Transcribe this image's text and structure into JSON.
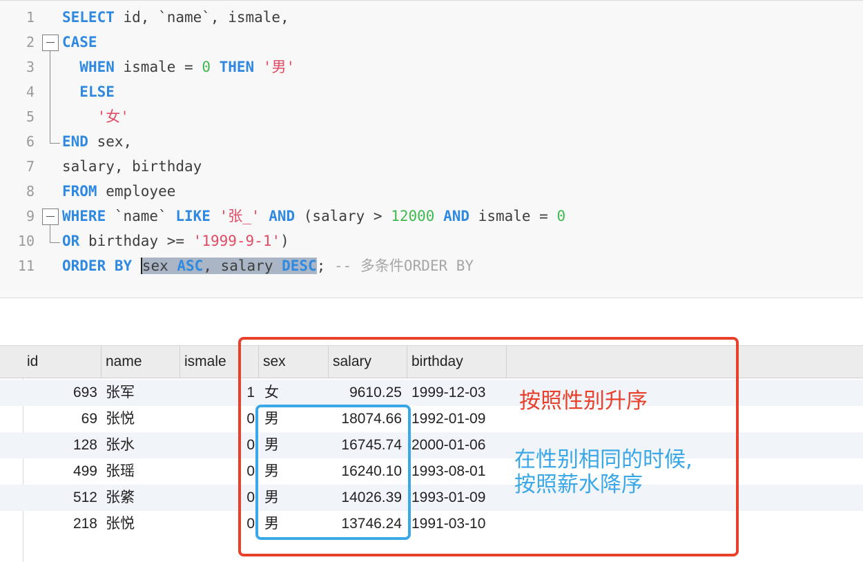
{
  "editor": {
    "line_numbers": [
      "1",
      "2",
      "3",
      "4",
      "5",
      "6",
      "7",
      "8",
      "9",
      "10",
      "11"
    ],
    "lines": [
      [
        {
          "t": "SELECT",
          "c": "kw"
        },
        {
          "t": " id, `name`, ismale,",
          "c": ""
        }
      ],
      [
        {
          "t": "CASE",
          "c": "kw"
        }
      ],
      [
        {
          "t": "  ",
          "c": ""
        },
        {
          "t": "WHEN",
          "c": "kw"
        },
        {
          "t": " ismale = ",
          "c": ""
        },
        {
          "t": "0",
          "c": "num"
        },
        {
          "t": " ",
          "c": ""
        },
        {
          "t": "THEN",
          "c": "kw"
        },
        {
          "t": " ",
          "c": ""
        },
        {
          "t": "'男'",
          "c": "str"
        }
      ],
      [
        {
          "t": "  ",
          "c": ""
        },
        {
          "t": "ELSE",
          "c": "kw"
        }
      ],
      [
        {
          "t": "    ",
          "c": ""
        },
        {
          "t": "'女'",
          "c": "str"
        }
      ],
      [
        {
          "t": "END",
          "c": "kw"
        },
        {
          "t": " sex,",
          "c": ""
        }
      ],
      [
        {
          "t": "salary, birthday",
          "c": ""
        }
      ],
      [
        {
          "t": "FROM",
          "c": "kw"
        },
        {
          "t": " employee",
          "c": ""
        }
      ],
      [
        {
          "t": "WHERE",
          "c": "kw"
        },
        {
          "t": " `name` ",
          "c": ""
        },
        {
          "t": "LIKE",
          "c": "kw"
        },
        {
          "t": " ",
          "c": ""
        },
        {
          "t": "'张_'",
          "c": "str"
        },
        {
          "t": " ",
          "c": ""
        },
        {
          "t": "AND",
          "c": "kw"
        },
        {
          "t": " (salary > ",
          "c": ""
        },
        {
          "t": "12000",
          "c": "num"
        },
        {
          "t": " ",
          "c": ""
        },
        {
          "t": "AND",
          "c": "kw"
        },
        {
          "t": " ismale = ",
          "c": ""
        },
        {
          "t": "0",
          "c": "num"
        }
      ],
      [
        {
          "t": "OR",
          "c": "kw"
        },
        {
          "t": " birthday >= ",
          "c": ""
        },
        {
          "t": "'1999-9-1'",
          "c": "str"
        },
        {
          "t": ")",
          "c": ""
        }
      ],
      [
        {
          "t": "ORDER BY",
          "c": "kw"
        },
        {
          "t": " ",
          "c": ""
        },
        {
          "t": "sex ",
          "c": "hl"
        },
        {
          "t": "ASC",
          "c": "kw hl"
        },
        {
          "t": ", salary ",
          "c": "hl"
        },
        {
          "t": "DESC",
          "c": "kw hl"
        },
        {
          "t": "; ",
          "c": ""
        },
        {
          "t": "-- 多条件ORDER BY",
          "c": "cmt"
        }
      ]
    ]
  },
  "grid": {
    "columns": [
      "id",
      "name",
      "ismale",
      "sex",
      "salary",
      "birthday"
    ],
    "rows": [
      {
        "id": "693",
        "name": "张军",
        "ismale": "1",
        "sex": "女",
        "salary": "9610.25",
        "birthday": "1999-12-03"
      },
      {
        "id": "69",
        "name": "张悦",
        "ismale": "0",
        "sex": "男",
        "salary": "18074.66",
        "birthday": "1992-01-09"
      },
      {
        "id": "128",
        "name": "张水",
        "ismale": "0",
        "sex": "男",
        "salary": "16745.74",
        "birthday": "2000-01-06"
      },
      {
        "id": "499",
        "name": "张瑶",
        "ismale": "0",
        "sex": "男",
        "salary": "16240.10",
        "birthday": "1993-08-01"
      },
      {
        "id": "512",
        "name": "张綮",
        "ismale": "0",
        "sex": "男",
        "salary": "14026.39",
        "birthday": "1993-01-09"
      },
      {
        "id": "218",
        "name": "张悦",
        "ismale": "0",
        "sex": "男",
        "salary": "13746.24",
        "birthday": "1991-03-10"
      }
    ]
  },
  "annotations": {
    "red_note": "按照性别升序",
    "blue_note_line1": "在性别相同的时候,",
    "blue_note_line2": "按照薪水降序",
    "red_color": "#e8402b",
    "blue_color": "#3aa7e8"
  }
}
